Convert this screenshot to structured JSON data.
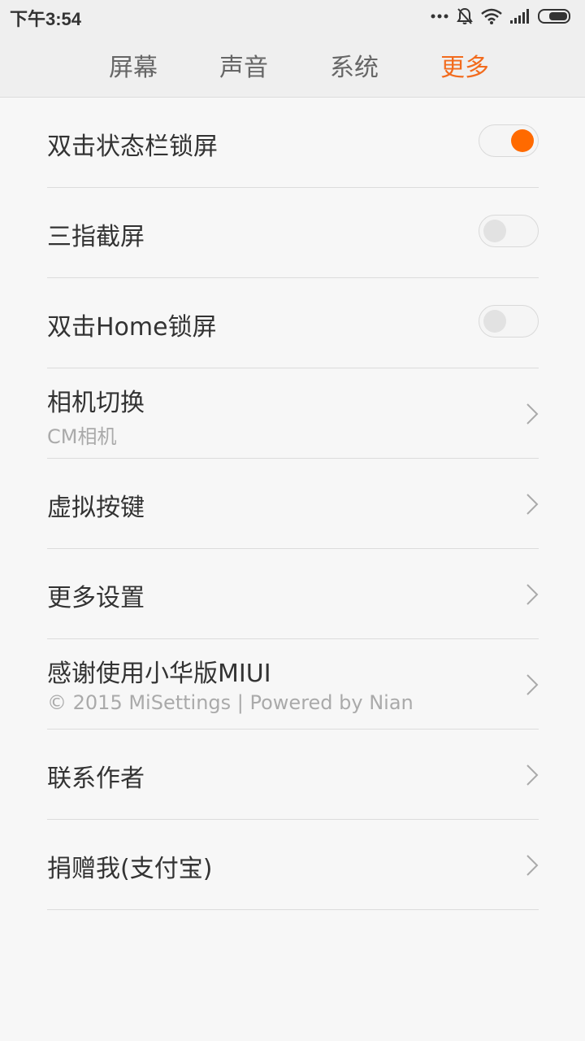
{
  "status_bar": {
    "time": "下午3:54",
    "icons": [
      "dots-icon",
      "bell-off-icon",
      "wifi-icon",
      "signal-icon",
      "battery-icon"
    ]
  },
  "tabs": [
    {
      "label": "屏幕",
      "active": false
    },
    {
      "label": "声音",
      "active": false
    },
    {
      "label": "系统",
      "active": false
    },
    {
      "label": "更多",
      "active": true
    }
  ],
  "accent_color": "#f26b1d",
  "items": [
    {
      "title": "双击状态栏锁屏",
      "control": "toggle",
      "on": true
    },
    {
      "title": "三指截屏",
      "control": "toggle",
      "on": false
    },
    {
      "title": "双击Home锁屏",
      "control": "toggle",
      "on": false
    },
    {
      "title": "相机切换",
      "subtitle": "CM相机",
      "control": "chevron-right-icon"
    },
    {
      "title": "虚拟按键",
      "control": "chevron-right-icon"
    },
    {
      "title": "更多设置",
      "control": "chevron-right-icon"
    },
    {
      "title": "感谢使用小华版MIUI",
      "subtitle": "© 2015 MiSettings | Powered by Nian",
      "control": "chevron-right-icon"
    },
    {
      "title": "联系作者",
      "control": "chevron-right-icon"
    },
    {
      "title": "捐赠我(支付宝)",
      "control": "chevron-right-icon"
    }
  ]
}
